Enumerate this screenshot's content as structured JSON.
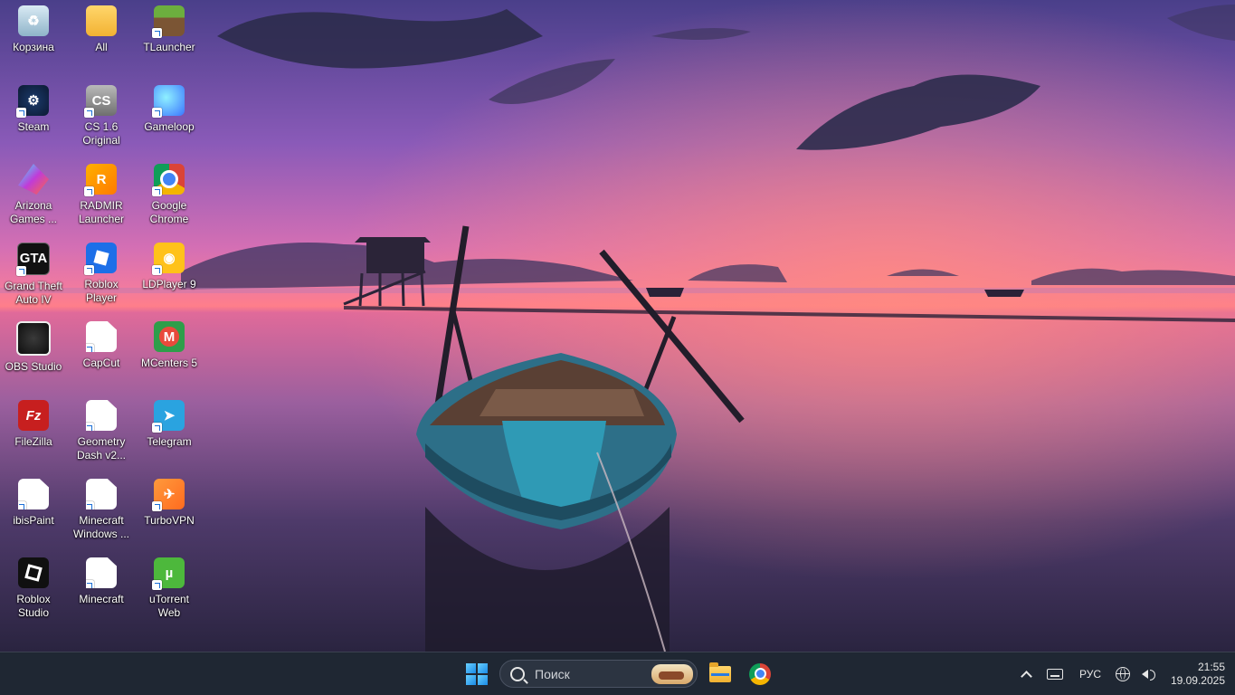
{
  "desktop": {
    "icons": [
      {
        "label": "Корзина",
        "icon": "recycle-bin-icon"
      },
      {
        "label": "All",
        "icon": "folder-icon"
      },
      {
        "label": "TLauncher",
        "icon": "tlauncher-icon"
      },
      {
        "label": "Steam",
        "icon": "steam-icon"
      },
      {
        "label": "CS 1.6\nOriginal",
        "icon": "counter-strike-icon"
      },
      {
        "label": "Gameloop",
        "icon": "gameloop-icon"
      },
      {
        "label": "Arizona\nGames ...",
        "icon": "arizona-games-icon"
      },
      {
        "label": "RADMIR\nLauncher",
        "icon": "radmir-launcher-icon"
      },
      {
        "label": "Google\nChrome",
        "icon": "chrome-icon"
      },
      {
        "label": "Grand Theft\nAuto IV",
        "icon": "gta-iv-icon"
      },
      {
        "label": "Roblox Player",
        "icon": "roblox-player-icon"
      },
      {
        "label": "LDPlayer 9",
        "icon": "ldplayer-icon"
      },
      {
        "label": "OBS Studio",
        "icon": "obs-studio-icon"
      },
      {
        "label": "CapCut",
        "icon": "generic-file-icon"
      },
      {
        "label": "MCenters 5",
        "icon": "mcenters-icon"
      },
      {
        "label": "FileZilla",
        "icon": "filezilla-icon"
      },
      {
        "label": "Geometry\nDash v2...",
        "icon": "generic-file-icon"
      },
      {
        "label": "Telegram",
        "icon": "telegram-icon"
      },
      {
        "label": "ibisPaint",
        "icon": "generic-file-icon"
      },
      {
        "label": "Minecraft\nWindows ...",
        "icon": "generic-file-icon"
      },
      {
        "label": "TurboVPN",
        "icon": "turbovpn-icon"
      },
      {
        "label": "Roblox\nStudio",
        "icon": "roblox-studio-icon"
      },
      {
        "label": "Minecraft",
        "icon": "generic-file-icon"
      },
      {
        "label": "uTorrent\nWeb",
        "icon": "utorrent-icon"
      }
    ]
  },
  "taskbar": {
    "search_placeholder": "Поиск",
    "language": "РУС",
    "time": "21:55",
    "date": "19.09.2025"
  },
  "colors": {
    "taskbar_bg": "#1f2733",
    "accent": "#1a8ae6"
  }
}
